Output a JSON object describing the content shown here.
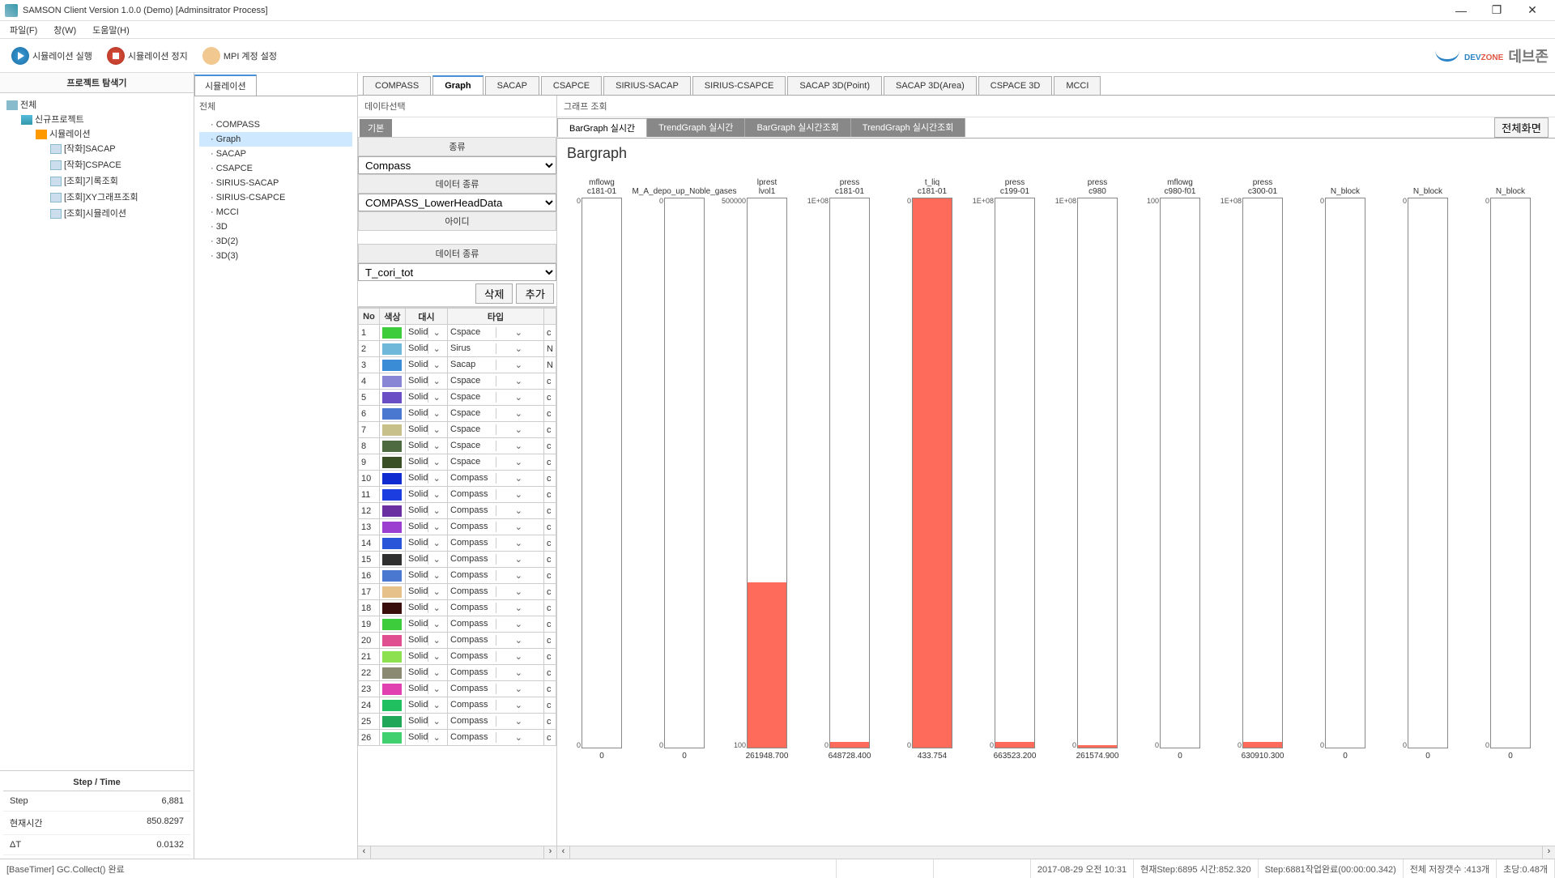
{
  "window": {
    "title": "SAMSON Client Version 1.0.0 (Demo) [Adminsitrator Process]"
  },
  "menu": {
    "file": "파일(F)",
    "window": "창(W)",
    "help": "도움말(H)"
  },
  "toolbar": {
    "runSim": "시뮬레이션 실행",
    "stopSim": "시뮬레이션 정지",
    "mpi": "MPI 계정 설정",
    "brand_prefix": "DEV",
    "brand_zone": "ZONE",
    "brand_ko": "데브존"
  },
  "projectPanel": {
    "title": "프로젝트 탐색기",
    "root": "전체",
    "proj": "신규프로젝트",
    "sim": "시뮬레이션",
    "leaves": [
      "[작화]SACAP",
      "[작화]CSPACE",
      "[조회]기록조회",
      "[조회]XY그래프조회",
      "[조회]시뮬레이션"
    ]
  },
  "steptime": {
    "title": "Step / Time",
    "stepLbl": "Step",
    "stepVal": "6,881",
    "timeLbl": "현재시간",
    "timeVal": "850.8297",
    "dtLbl": "ΔT",
    "dtVal": "0.0132"
  },
  "simPanel": {
    "tab": "시뮬레이션",
    "all": "전체",
    "items": [
      "COMPASS",
      "Graph",
      "SACAP",
      "CSAPCE",
      "SIRIUS-SACAP",
      "SIRIUS-CSAPCE",
      "MCCI",
      "3D",
      "3D(2)",
      "3D(3)"
    ],
    "selected": 1
  },
  "subtabs": {
    "items": [
      "COMPASS",
      "Graph",
      "SACAP",
      "CSAPCE",
      "SIRIUS-SACAP",
      "SIRIUS-CSAPCE",
      "SACAP 3D(Point)",
      "SACAP 3D(Area)",
      "CSPACE 3D",
      "MCCI"
    ],
    "active": 1
  },
  "dataSelect": {
    "title": "데이타선택",
    "basic": "기본",
    "h_type": "종류",
    "v_type": "Compass",
    "h_dataType": "데이터 종류",
    "v_dataType": "COMPASS_LowerHeadData",
    "h_id": "아이디",
    "h_dataType2": "데이터 종류",
    "v_dataType2": "T_cori_tot",
    "btn_del": "삭제",
    "btn_add": "추가",
    "cols": {
      "no": "No",
      "color": "색상",
      "dash": "대시",
      "type": "타입"
    },
    "rows": [
      {
        "no": 1,
        "color": "#3ccc3c",
        "dash": "Solid",
        "type": "Cspace",
        "t2": "c"
      },
      {
        "no": 2,
        "color": "#70b8da",
        "dash": "Solid",
        "type": "Sirus",
        "t2": "N"
      },
      {
        "no": 3,
        "color": "#3a8cd6",
        "dash": "Solid",
        "type": "Sacap",
        "t2": "N"
      },
      {
        "no": 4,
        "color": "#8a86d6",
        "dash": "Solid",
        "type": "Cspace",
        "t2": "c"
      },
      {
        "no": 5,
        "color": "#6a4ec6",
        "dash": "Solid",
        "type": "Cspace",
        "t2": "c"
      },
      {
        "no": 6,
        "color": "#4a78d0",
        "dash": "Solid",
        "type": "Cspace",
        "t2": "c"
      },
      {
        "no": 7,
        "color": "#c7c08a",
        "dash": "Solid",
        "type": "Cspace",
        "t2": "c"
      },
      {
        "no": 8,
        "color": "#4d6a40",
        "dash": "Solid",
        "type": "Cspace",
        "t2": "c"
      },
      {
        "no": 9,
        "color": "#3a4f25",
        "dash": "Solid",
        "type": "Cspace",
        "t2": "c"
      },
      {
        "no": 10,
        "color": "#102bd0",
        "dash": "Solid",
        "type": "Compass",
        "t2": "c"
      },
      {
        "no": 11,
        "color": "#1c3de0",
        "dash": "Solid",
        "type": "Compass",
        "t2": "c"
      },
      {
        "no": 12,
        "color": "#6a2fa0",
        "dash": "Solid",
        "type": "Compass",
        "t2": "c"
      },
      {
        "no": 13,
        "color": "#9a3fcf",
        "dash": "Solid",
        "type": "Compass",
        "t2": "c"
      },
      {
        "no": 14,
        "color": "#2a55d8",
        "dash": "Solid",
        "type": "Compass",
        "t2": "c"
      },
      {
        "no": 15,
        "color": "#303030",
        "dash": "Solid",
        "type": "Compass",
        "t2": "c"
      },
      {
        "no": 16,
        "color": "#4a78d0",
        "dash": "Solid",
        "type": "Compass",
        "t2": "c"
      },
      {
        "no": 17,
        "color": "#e6c28a",
        "dash": "Solid",
        "type": "Compass",
        "t2": "c"
      },
      {
        "no": 18,
        "color": "#3a0d0d",
        "dash": "Solid",
        "type": "Compass",
        "t2": "c"
      },
      {
        "no": 19,
        "color": "#3ccc3c",
        "dash": "Solid",
        "type": "Compass",
        "t2": "c"
      },
      {
        "no": 20,
        "color": "#e05090",
        "dash": "Solid",
        "type": "Compass",
        "t2": "c"
      },
      {
        "no": 21,
        "color": "#8de050",
        "dash": "Solid",
        "type": "Compass",
        "t2": "c"
      },
      {
        "no": 22,
        "color": "#8a8a72",
        "dash": "Solid",
        "type": "Compass",
        "t2": "c"
      },
      {
        "no": 23,
        "color": "#e040b0",
        "dash": "Solid",
        "type": "Compass",
        "t2": "c"
      },
      {
        "no": 24,
        "color": "#20c060",
        "dash": "Solid",
        "type": "Compass",
        "t2": "c"
      },
      {
        "no": 25,
        "color": "#20a858",
        "dash": "Solid",
        "type": "Compass",
        "t2": "c"
      },
      {
        "no": 26,
        "color": "#40d070",
        "dash": "Solid",
        "type": "Compass",
        "t2": "c"
      }
    ]
  },
  "graph": {
    "title": "그래프 조회",
    "tabs": [
      "BarGraph 실시간",
      "TrendGraph 실시간",
      "BarGraph 실시간조회",
      "TrendGraph 실시간조회"
    ],
    "activeTab": 0,
    "full": "전체화면",
    "chartTitle": "Bargraph"
  },
  "chart_data": {
    "type": "bar",
    "title": "Bargraph",
    "series": [
      {
        "label1": "mflowg",
        "label2": "c181-01",
        "ymin": 0,
        "ymax": 0,
        "value": 0,
        "display": "0",
        "fill": 0
      },
      {
        "label1": "M_A_depo_up_Noble_gases",
        "label2": "",
        "ymin": 0,
        "ymax": 0,
        "value": 0,
        "display": "0",
        "fill": 0
      },
      {
        "label1": "lprest",
        "label2": "lvol1",
        "ymin": 100,
        "ymax": 500000,
        "value": 261948.7,
        "display": "261948.700",
        "fill": 0.3
      },
      {
        "label1": "press",
        "label2": "c181-01",
        "ymin": 0,
        "ymax": "1E+08",
        "value": 648728.4,
        "display": "648728.400",
        "fill": 0.01
      },
      {
        "label1": "t_liq",
        "label2": "c181-01",
        "ymin": 0,
        "ymax": 0,
        "value": 433.754,
        "display": "433.754",
        "fill": 1.0
      },
      {
        "label1": "press",
        "label2": "c199-01",
        "ymin": 0,
        "ymax": "1E+08",
        "value": 663523.2,
        "display": "663523.200",
        "fill": 0.01
      },
      {
        "label1": "press",
        "label2": "c980",
        "ymin": 0,
        "ymax": "1E+08",
        "value": 261574.9,
        "display": "261574.900",
        "fill": 0.005
      },
      {
        "label1": "mflowg",
        "label2": "c980-f01",
        "ymin": 0,
        "ymax": 100,
        "value": 0,
        "display": "0",
        "fill": 0
      },
      {
        "label1": "press",
        "label2": "c300-01",
        "ymin": 0,
        "ymax": "1E+08",
        "value": 630910.3,
        "display": "630910.300",
        "fill": 0.01
      },
      {
        "label1": "N_block",
        "label2": "",
        "ymin": 0,
        "ymax": 0,
        "value": 0,
        "display": "0",
        "fill": 0
      },
      {
        "label1": "N_block",
        "label2": "",
        "ymin": 0,
        "ymax": 0,
        "value": 0,
        "display": "0",
        "fill": 0
      },
      {
        "label1": "N_block",
        "label2": "",
        "ymin": 0,
        "ymax": 0,
        "value": 0,
        "display": "0",
        "fill": 0
      }
    ]
  },
  "status": {
    "left": "[BaseTimer] GC.Collect() 완료",
    "datetime": "2017-08-29 오전 10:31",
    "curStep": "현재Step:6895 시간:852.320",
    "jobDone": "Step:6881작업완료(00:00:00.342)",
    "saveCount": "전체 저장갯수 :413개",
    "sec": "초당:0.48개"
  }
}
